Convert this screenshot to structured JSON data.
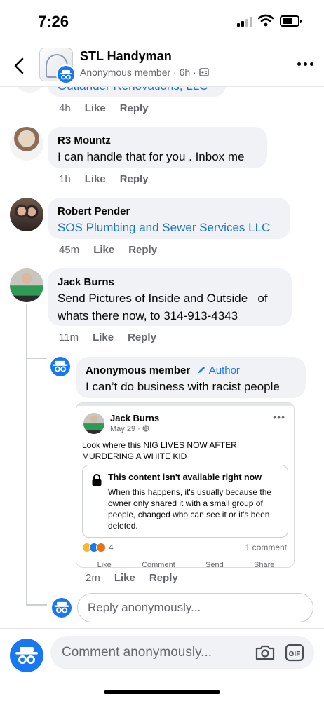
{
  "status_bar": {
    "time": "7:26"
  },
  "header": {
    "title": "STL Handyman",
    "subtitle": "Anonymous member · 6h ·",
    "back_icon": "chevron-left-icon",
    "more_icon": "more-horizontal-icon"
  },
  "previous_comment": {
    "text_partial": "Outlander Renovations, LLC",
    "time": "4h",
    "like": "Like",
    "reply": "Reply"
  },
  "comments": [
    {
      "name": "R3 Mountz",
      "text": "I can handle that for you . Inbox me",
      "time": "1h",
      "like": "Like",
      "reply": "Reply"
    },
    {
      "name": "Robert Pender",
      "text": "SOS Plumbing and Sewer Services LLC",
      "time": "45m",
      "like": "Like",
      "reply": "Reply"
    },
    {
      "name": "Jack Burns",
      "text": "Send Pictures of Inside and Outside   of whats there now, to 314-913-4343",
      "time": "11m",
      "like": "Like",
      "reply": "Reply"
    }
  ],
  "reply": {
    "name": "Anonymous member",
    "author_tag": "Author",
    "text": "I can’t do business with racist people",
    "time": "2m",
    "like": "Like",
    "reply": "Reply"
  },
  "shared_post": {
    "name": "Jack Burns",
    "date": "May 29 ·",
    "text": "Look where this NIG LIVES NOW AFTER MURDERING A WHITE KID",
    "unavailable_title": "This content isn't available right now",
    "unavailable_body": "When this happens, it's usually because the owner only shared it with a small group of people, changed who can see it or it's been deleted.",
    "reaction_count": "4",
    "comment_count": "1 comment",
    "actions": [
      "Like",
      "Comment",
      "Send",
      "Share"
    ]
  },
  "reply_input": {
    "placeholder": "Reply anonymously..."
  },
  "footer": {
    "placeholder": "Comment anonymously..."
  },
  "colors": {
    "accent": "#1877f2",
    "link": "#1a73c8",
    "bubble": "#f0f2f5",
    "muted": "#65676b"
  }
}
